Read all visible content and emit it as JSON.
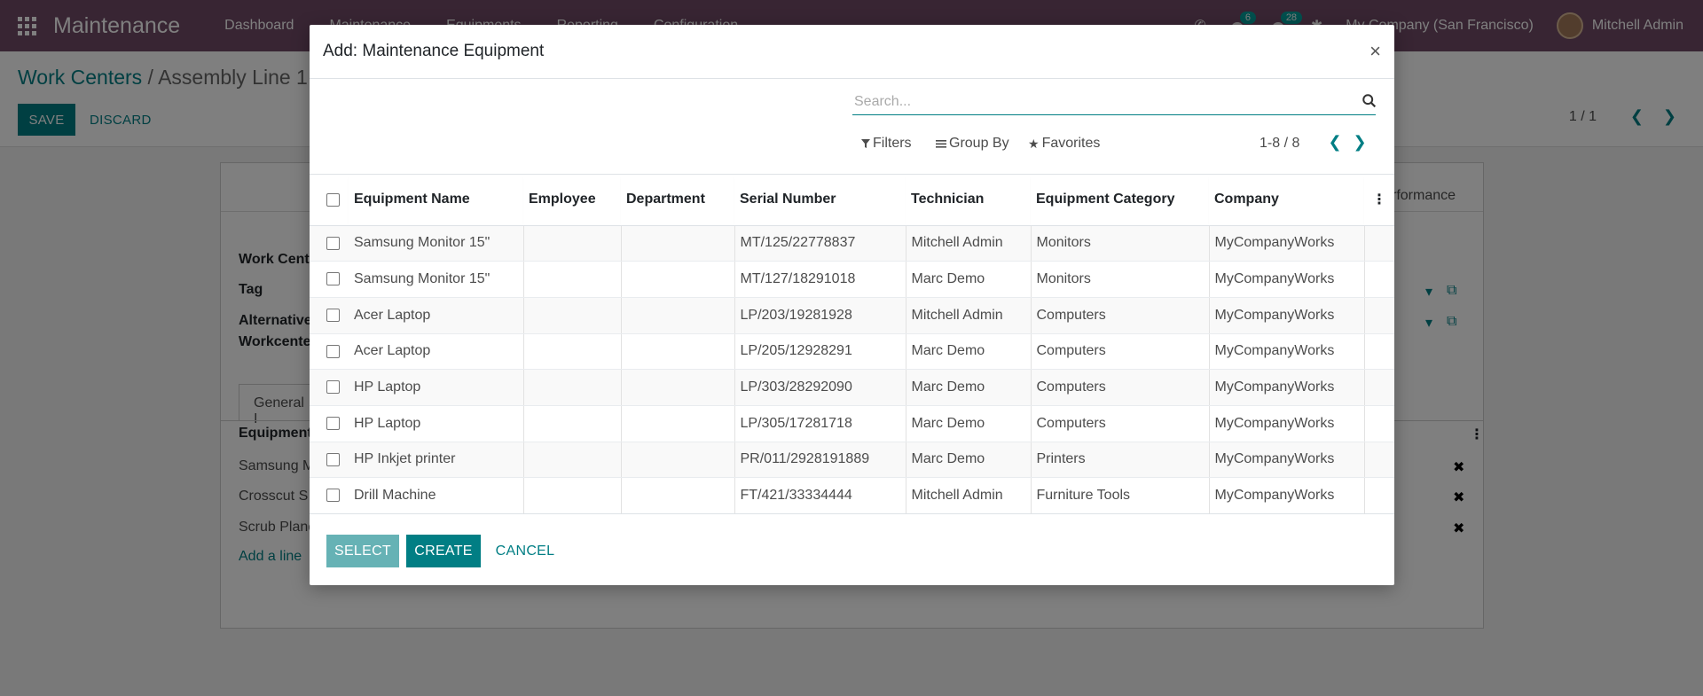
{
  "navbar": {
    "app_name": "Maintenance",
    "menu": [
      "Dashboard",
      "Maintenance",
      "Equipments",
      "Reporting",
      "Configuration"
    ],
    "activity_badge": "6",
    "messages_badge": "28",
    "company": "My Company (San Francisco)",
    "user": "Mitchell Admin"
  },
  "control": {
    "breadcrumb_parent": "Work Centers",
    "breadcrumb_sep": " / ",
    "breadcrumb_current": "Assembly Line 1",
    "save_label": "SAVE",
    "discard_label": "DISCARD",
    "pager": "1 / 1"
  },
  "form": {
    "label_workcenter": "Work Cente",
    "label_tag": "Tag",
    "label_alt_1": "Alternative",
    "label_alt_2": "Workcenter",
    "tab_general": "General I",
    "tab_performance": "rformance",
    "equipment_header": "Equipment",
    "rows": [
      "Samsung M",
      "Crosscut S",
      "Scrub Plane"
    ],
    "add_line": "Add a line"
  },
  "modal": {
    "title": "Add: Maintenance Equipment",
    "close": "×",
    "search_placeholder": "Search...",
    "filters": "Filters",
    "group_by": "Group By",
    "favorites": "Favorites",
    "pager": "1-8 / 8",
    "columns": [
      "Equipment Name",
      "Employee",
      "Department",
      "Serial Number",
      "Technician",
      "Equipment Category",
      "Company"
    ],
    "rows": [
      {
        "name": "Samsung Monitor 15\"",
        "employee": "",
        "department": "",
        "serial": "MT/125/22778837",
        "technician": "Mitchell Admin",
        "category": "Monitors",
        "company": "MyCompanyWorks"
      },
      {
        "name": "Samsung Monitor 15\"",
        "employee": "",
        "department": "",
        "serial": "MT/127/18291018",
        "technician": "Marc Demo",
        "category": "Monitors",
        "company": "MyCompanyWorks"
      },
      {
        "name": "Acer Laptop",
        "employee": "",
        "department": "",
        "serial": "LP/203/19281928",
        "technician": "Mitchell Admin",
        "category": "Computers",
        "company": "MyCompanyWorks"
      },
      {
        "name": "Acer Laptop",
        "employee": "",
        "department": "",
        "serial": "LP/205/12928291",
        "technician": "Marc Demo",
        "category": "Computers",
        "company": "MyCompanyWorks"
      },
      {
        "name": "HP Laptop",
        "employee": "",
        "department": "",
        "serial": "LP/303/28292090",
        "technician": "Marc Demo",
        "category": "Computers",
        "company": "MyCompanyWorks"
      },
      {
        "name": "HP Laptop",
        "employee": "",
        "department": "",
        "serial": "LP/305/17281718",
        "technician": "Marc Demo",
        "category": "Computers",
        "company": "MyCompanyWorks"
      },
      {
        "name": "HP Inkjet printer",
        "employee": "",
        "department": "",
        "serial": "PR/011/2928191889",
        "technician": "Marc Demo",
        "category": "Printers",
        "company": "MyCompanyWorks"
      },
      {
        "name": "Drill Machine",
        "employee": "",
        "department": "",
        "serial": "FT/421/33334444",
        "technician": "Mitchell Admin",
        "category": "Furniture Tools",
        "company": "MyCompanyWorks"
      }
    ],
    "select_label": "SELECT",
    "create_label": "CREATE",
    "cancel_label": "CANCEL"
  },
  "colors": {
    "navbar": "#714b67",
    "primary": "#017e84",
    "select_button": "#66b2b5"
  }
}
